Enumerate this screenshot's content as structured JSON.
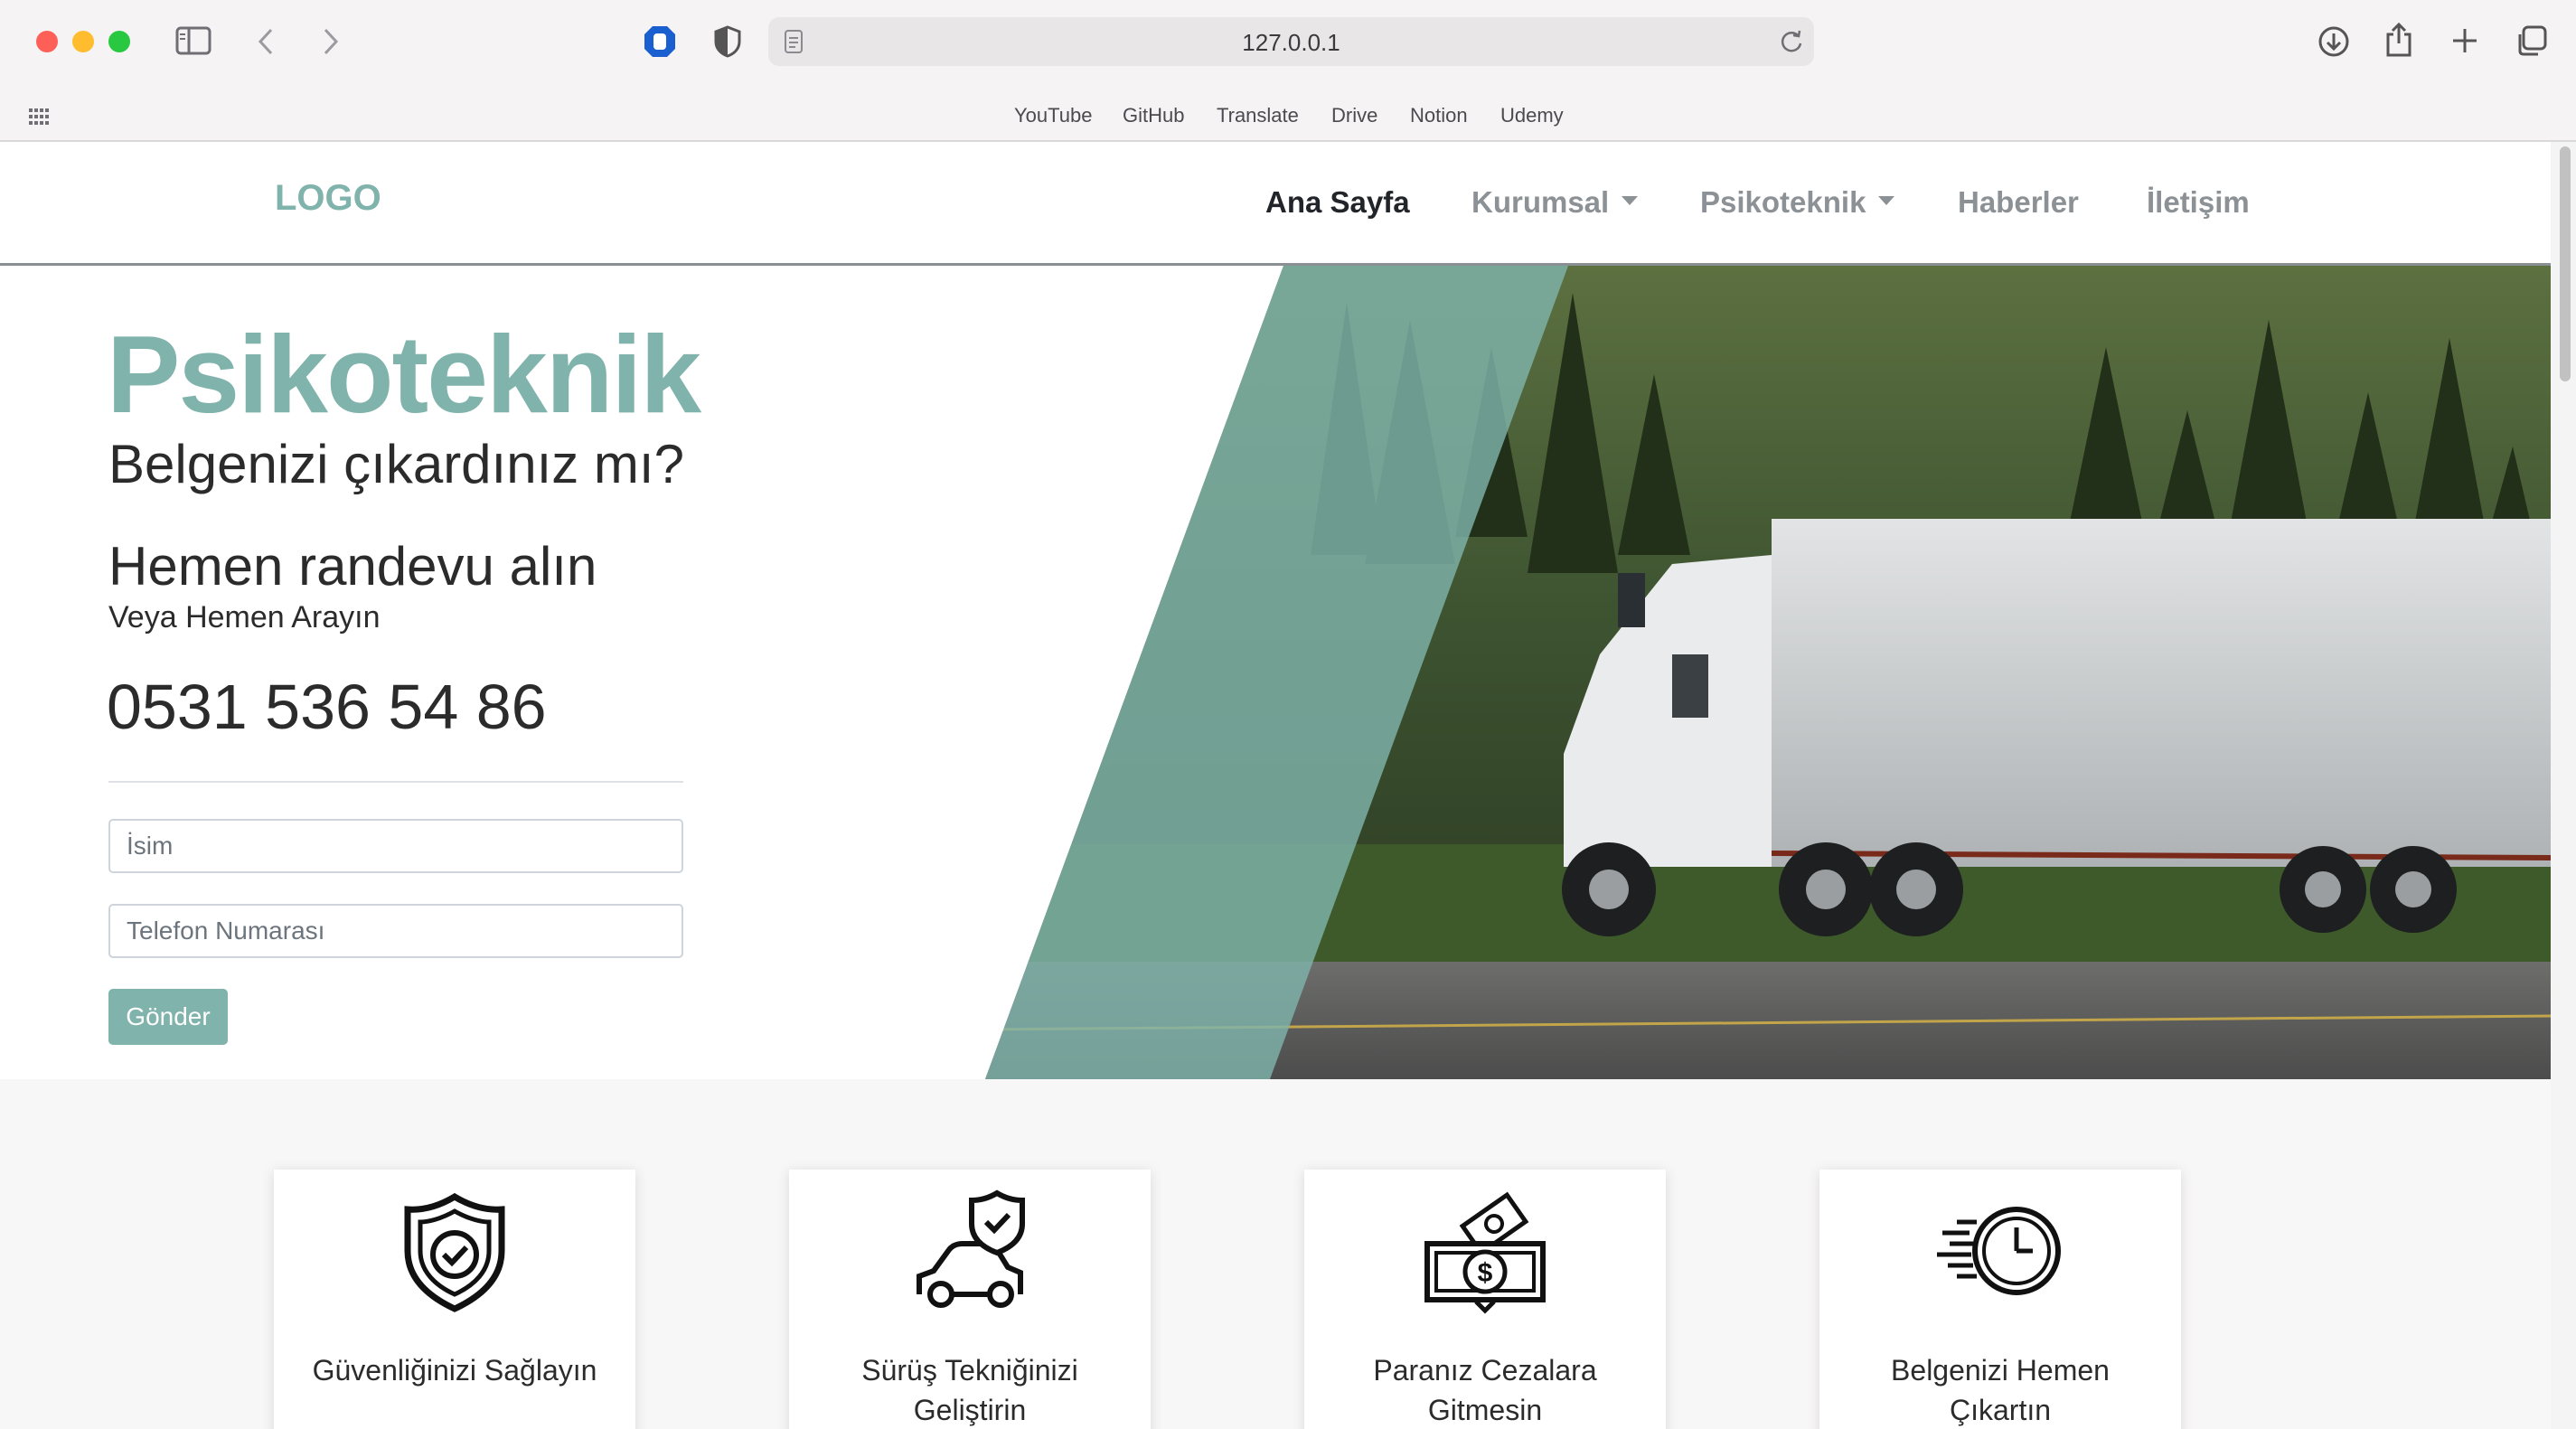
{
  "browser": {
    "url": "127.0.0.1",
    "bookmarks": [
      "YouTube",
      "GitHub",
      "Translate",
      "Drive",
      "Notion",
      "Udemy"
    ],
    "icons": [
      "sidebar-icon",
      "back-icon",
      "forward-icon",
      "privacy-icon",
      "shield-icon",
      "page-icon",
      "reload-icon",
      "download-icon",
      "share-icon",
      "new-tab-icon",
      "tab-overview-icon",
      "apps-grid-icon"
    ]
  },
  "site": {
    "logo": "LOGO",
    "nav": [
      "Ana Sayfa",
      "Kurumsal",
      "Psikoteknik",
      "Haberler",
      "İletişim"
    ],
    "accent_color": "#7fb3ab"
  },
  "hero": {
    "title": "Psikoteknik",
    "subtitle": "Belgenizi çıkardınız mı?",
    "appointment": "Hemen randevu alın",
    "or_call": "Veya Hemen Arayın",
    "phone": "0531 536 54 86",
    "name_placeholder": "İsim",
    "phone_placeholder": "Telefon Numarası",
    "submit_label": "Gönder",
    "image": "truck-on-highway-photo"
  },
  "features": [
    {
      "icon": "shield-check-icon",
      "text": "Güvenliğinizi Sağlayın"
    },
    {
      "icon": "car-shield-icon",
      "text": "Sürüş Tekniğinizi Geliştirin"
    },
    {
      "icon": "money-icon",
      "text": "Paranız Cezalara Gitmesin"
    },
    {
      "icon": "fast-clock-icon",
      "text": "Belgenizi Hemen Çıkartın"
    }
  ]
}
